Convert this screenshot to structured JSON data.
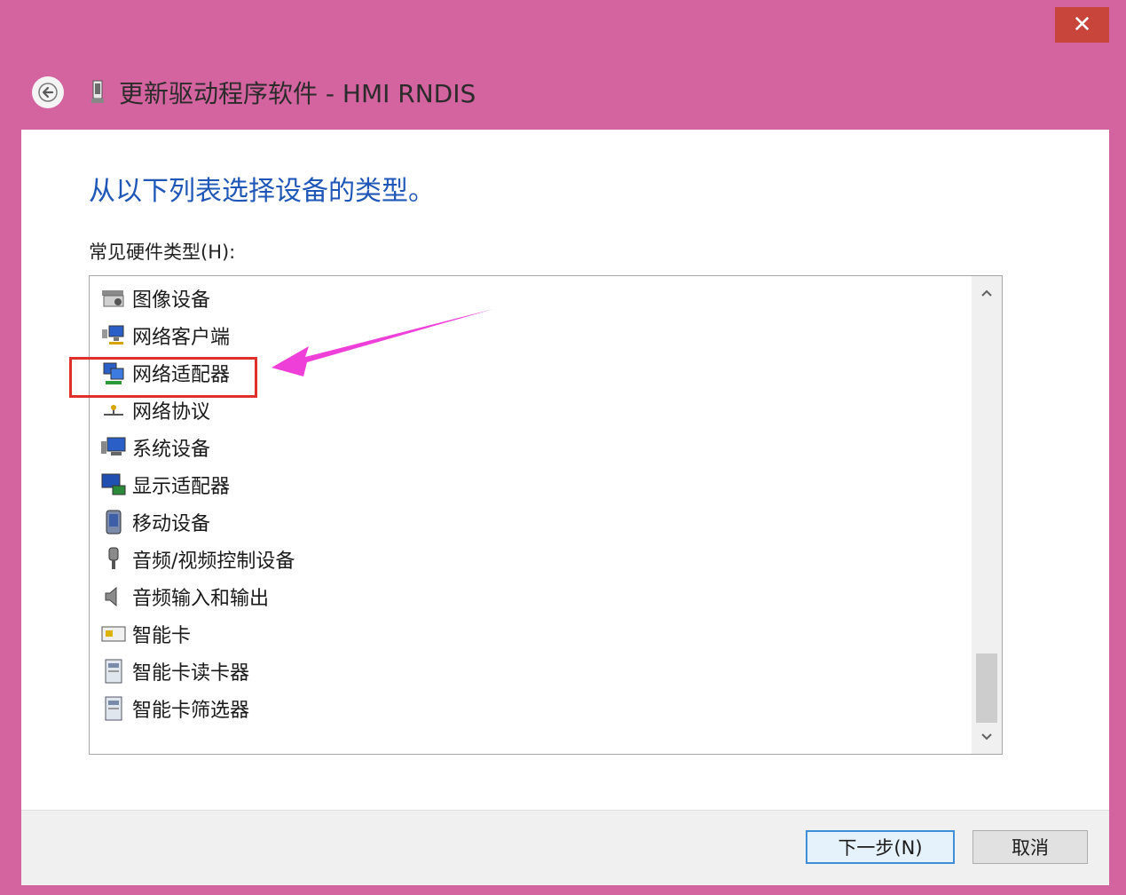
{
  "window": {
    "title": "更新驱动程序软件 - HMI RNDIS",
    "close_label": "✕"
  },
  "content": {
    "instruction": "从以下列表选择设备的类型。",
    "list_label": "常见硬件类型(H):",
    "items": [
      {
        "label": "图像设备",
        "icon": "imaging-device-icon"
      },
      {
        "label": "网络客户端",
        "icon": "network-client-icon"
      },
      {
        "label": "网络适配器",
        "icon": "network-adapter-icon"
      },
      {
        "label": "网络协议",
        "icon": "network-protocol-icon"
      },
      {
        "label": "系统设备",
        "icon": "system-device-icon"
      },
      {
        "label": "显示适配器",
        "icon": "display-adapter-icon"
      },
      {
        "label": "移动设备",
        "icon": "mobile-device-icon"
      },
      {
        "label": "音频/视频控制设备",
        "icon": "av-control-device-icon"
      },
      {
        "label": "音频输入和输出",
        "icon": "audio-io-icon"
      },
      {
        "label": "智能卡",
        "icon": "smart-card-icon"
      },
      {
        "label": "智能卡读卡器",
        "icon": "smart-card-reader-icon"
      },
      {
        "label": "智能卡筛选器",
        "icon": "smart-card-filter-icon"
      }
    ],
    "highlighted_item": "网络适配器"
  },
  "footer": {
    "next_label": "下一步(N)",
    "cancel_label": "取消"
  },
  "colors": {
    "frame": "#d464a0",
    "instruction": "#1f57b8",
    "highlight": "#e0302b",
    "arrow": "#ee3fd8"
  }
}
